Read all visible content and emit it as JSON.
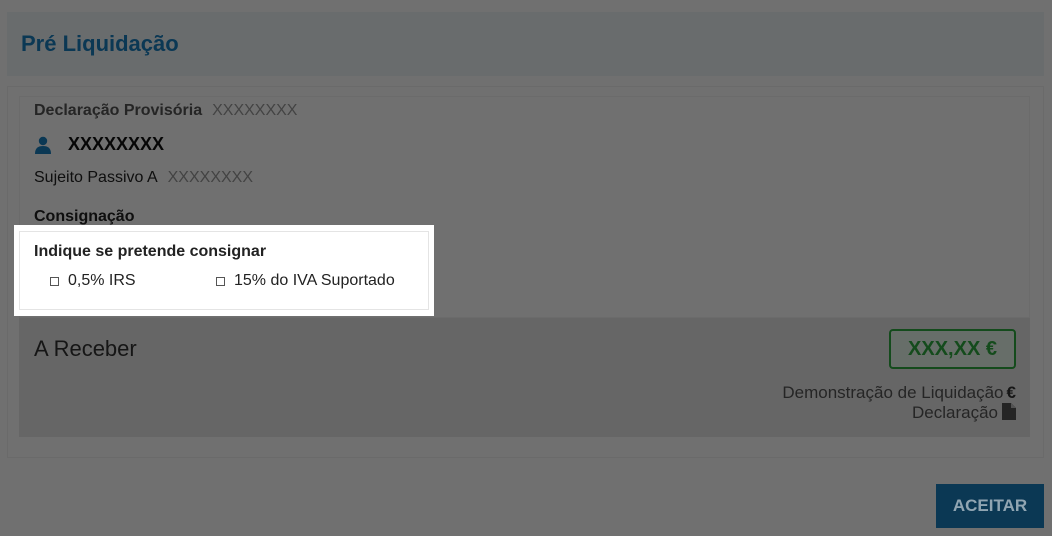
{
  "header": {
    "title": "Pré Liquidação"
  },
  "declaracao": {
    "label": "Declaração Provisória",
    "value": "XXXXXXXX"
  },
  "user": {
    "icon": "user-icon",
    "name": "XXXXXXXX"
  },
  "sujeito": {
    "label": "Sujeito Passivo A",
    "value": "XXXXXXXX"
  },
  "consignacao": {
    "title": "Consignação",
    "prompt": "Indique se pretende consignar",
    "options": [
      {
        "label": "0,5% IRS",
        "checked": false
      },
      {
        "label": "15% do IVA Suportado",
        "checked": false
      }
    ]
  },
  "receber": {
    "label": "A Receber",
    "amount": "XXX,XX €",
    "amount_color": "#2eaa40",
    "links": [
      {
        "label": "Demonstração de Liquidação",
        "icon": "euro-icon",
        "glyph": "€"
      },
      {
        "label": "Declaração",
        "icon": "document-icon"
      }
    ]
  },
  "actions": {
    "accept_label": "ACEITAR"
  },
  "colors": {
    "accent": "#1b7fc0",
    "success": "#2eaa40"
  }
}
